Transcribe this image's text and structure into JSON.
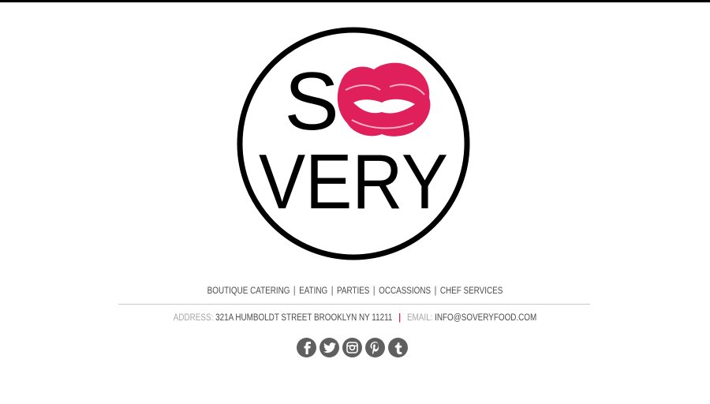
{
  "logo": {
    "line1": "S",
    "line2": "VERY",
    "kiss_color": "#e0205a"
  },
  "nav": {
    "items": [
      {
        "label": "BOUTIQUE CATERING"
      },
      {
        "label": "EATING"
      },
      {
        "label": "PARTIES"
      },
      {
        "label": "OCCASSIONS"
      },
      {
        "label": "CHEF SERVICES"
      }
    ],
    "separator": "|"
  },
  "contact": {
    "address_label": "ADDRESS:",
    "address_value": "321A HUMBOLDT STREET BROOKLYN NY 11211",
    "divider": "|",
    "email_label": "EMAIL:",
    "email_value": "INFO@SOVERYFOOD.COM"
  },
  "social": [
    {
      "name": "facebook-icon"
    },
    {
      "name": "twitter-icon"
    },
    {
      "name": "instagram-icon"
    },
    {
      "name": "pinterest-icon"
    },
    {
      "name": "tumblr-icon"
    }
  ],
  "colors": {
    "accent": "#e0205a",
    "text": "#4a4a4a",
    "muted": "#a7a7a7",
    "icon_bg": "#5f5f5f"
  }
}
